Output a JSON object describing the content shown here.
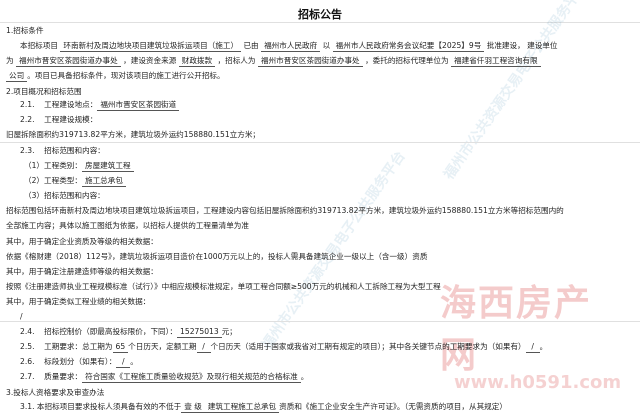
{
  "title": "招标公告",
  "s1": {
    "heading": "1.招标条件",
    "l1_a": "本招标项目",
    "l1_project": "环南新村及周边地块项目建筑垃圾拆运项目（施工）",
    "l1_b": "已由",
    "l1_gov": "福州市人民政府",
    "l1_c": "以",
    "l1_doc": "福州市人民政府常务会议纪要【2025】9号",
    "l1_d": "批准建设，",
    "l1_e": "建设单位",
    "l2_a": "为",
    "l2_unit": "福州市晋安区茶园街道办事处",
    "l2_b": "，建设资金来源",
    "l2_fund": "财政拨款",
    "l2_c": "，招标人为",
    "l2_tenderer": "福州市晋安区茶园街道办事处",
    "l2_d": "，委托的招标代理单位为",
    "l2_agent": "福建省仟羽工程咨询有限",
    "l3_agent2": "公司",
    "l3_rest": "。项目已具备招标条件，现对该项目的施工进行公开招标。"
  },
  "s2": {
    "heading": "2.项目概况和招标范围",
    "p1_num": "2.1.",
    "p1_label": "工程建设地点：",
    "p1_value": "福州市晋安区茶园街道",
    "p2_num": "2.2.",
    "p2_label": "工程建设规模：",
    "p2_text": "旧屋拆除面积约319713.82平方米，建筑垃圾外运约158880.151立方米；",
    "p3_num": "2.3.",
    "p3_label": "招标范围和内容：",
    "t1_label": "（1）工程类别：",
    "t1_value": "房屋建筑工程",
    "t2_label": "（2）工程类型：",
    "t2_value": "施工总承包",
    "t3_label": "（3）招标范围和内容：",
    "scope1": "招标范围包括环南新村及周边地块项目建筑垃圾拆运项目，工程建设内容包括旧屋拆除面积约319713.82平方米，建筑垃圾外运约158880.151立方米等招标范围内的",
    "scope2": "全部施工内容；具体以施工图纸为依据，以招标人提供的工程量清单为准",
    "q1": "其中，用于确定企业资质及等级的相关数据：",
    "q2": "依据《榕财建（2018）112号》，建筑垃圾拆运项目造价在1000万元以上的，投标人需具备建筑企业一级以上（含一级）资质",
    "q3": "其中，用于确定注册建造师等级的相关数据：",
    "q4": "按照《注册建造师执业工程规模标准（试行）》中相应规模标准规定，单项工程合同额≥500万元的机械和人工拆除工程为大型工程",
    "q5": "其中，用于确定类似工程业绩的相关数据：",
    "q6": "/",
    "p4_num": "2.4.",
    "p4_label": "招标控制价（即最高投标限价，下同）：",
    "p4_value": "15275013",
    "p4_unit": "元；",
    "p5_num": "2.5.",
    "p5_a": "工期要求：总工期为",
    "p5_days": "65",
    "p5_b": "个日历天，定额工期",
    "p5_quota": "/",
    "p5_c": "个日历天（适用于国家或我省对工期有规定的项目）；其中各关键节点的工期要求为（如果有）",
    "p5_end": "/",
    "p5_tail": "。",
    "p6_num": "2.6.",
    "p6_a": "标段划分（如果有）：",
    "p6_value": "/",
    "p6_b": "。",
    "p7_num": "2.7.",
    "p7_a": "质量要求：",
    "p7_value": "符合国家《工程施工质量验收规范》及现行相关规范的合格标准",
    "p7_b": "。"
  },
  "s3": {
    "heading": "3.投标人资格要求及审查办法",
    "p1": "3.1. 本招标项目要求投标人须具备有效的不低于",
    "p1_level": "壹 级",
    "p1_b": "建筑工程施工总承包",
    "p1_c": "资质和《施工企业安全生产许可证》。（无需资质的项目，从其规定）"
  },
  "watermark": {
    "vertical": "福州市公共资源交易电子公共服务平台",
    "stamp_big": "海西房产网",
    "stamp_url": "www.h0591.com"
  },
  "colors": {
    "watermark": "#3c82aa",
    "stamp": "#d74646"
  }
}
